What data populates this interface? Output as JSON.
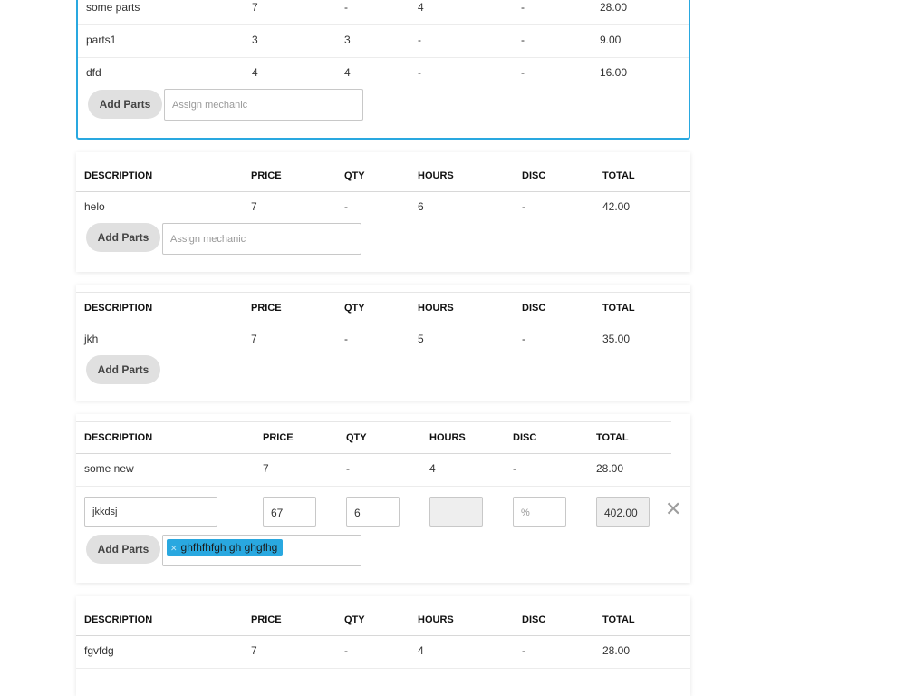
{
  "headers": {
    "description": "DESCRIPTION",
    "price": "PRICE",
    "qty": "QTY",
    "hours": "HOURS",
    "disc": "DISC",
    "total": "TOTAL"
  },
  "cards": [
    {
      "rows": [
        {
          "description": "some parts",
          "price": "7",
          "qty": "-",
          "hours": "4",
          "disc": "-",
          "total": "28.00"
        },
        {
          "description": "parts1",
          "price": "3",
          "qty": "3",
          "hours": "-",
          "disc": "-",
          "total": "9.00"
        },
        {
          "description": "dfd",
          "price": "4",
          "qty": "4",
          "hours": "-",
          "disc": "-",
          "total": "16.00"
        }
      ],
      "add_parts_label": "Add Parts",
      "mechanic_placeholder": "Assign mechanic"
    },
    {
      "rows": [
        {
          "description": "helo",
          "price": "7",
          "qty": "-",
          "hours": "6",
          "disc": "-",
          "total": "42.00"
        }
      ],
      "add_parts_label": "Add Parts",
      "mechanic_placeholder": "Assign mechanic"
    },
    {
      "rows": [
        {
          "description": "jkh",
          "price": "7",
          "qty": "-",
          "hours": "5",
          "disc": "-",
          "total": "35.00"
        }
      ],
      "add_parts_label": "Add Parts"
    },
    {
      "rows": [
        {
          "description": "some new",
          "price": "7",
          "qty": "-",
          "hours": "4",
          "disc": "-",
          "total": "28.00"
        }
      ],
      "edit_row": {
        "description": "jkkdsj",
        "price": "67",
        "qty": "6",
        "hours": "",
        "disc_placeholder": "%",
        "total": "402.00"
      },
      "add_parts_label": "Add Parts",
      "mechanic_tag": "ghfhfhfgh gh ghgfhg"
    },
    {
      "rows": [
        {
          "description": "fgvfdg",
          "price": "7",
          "qty": "-",
          "hours": "4",
          "disc": "-",
          "total": "28.00"
        }
      ]
    }
  ]
}
